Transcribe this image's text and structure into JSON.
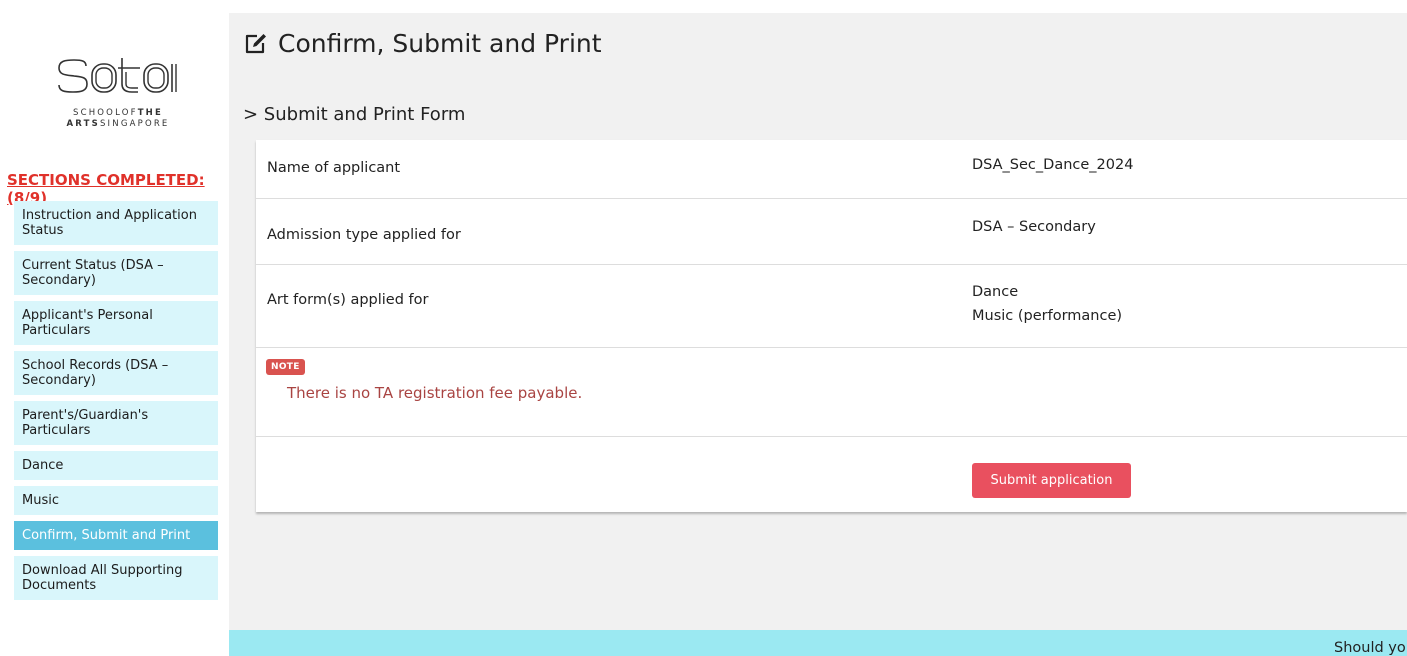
{
  "logo": {
    "wordmark": "sota",
    "line1_light": "SCHOOLOF",
    "line1_bold": "THE",
    "line2_bold": "ARTS",
    "line2_light": "SINGAPORE"
  },
  "sidebar": {
    "sections_completed": "SECTIONS COMPLETED:(8/9)",
    "items": [
      {
        "label": "Instruction and Application Status"
      },
      {
        "label": "Current Status (DSA – Secondary)"
      },
      {
        "label": "Applicant's Personal Particulars"
      },
      {
        "label": "School Records (DSA – Secondary)"
      },
      {
        "label": "Parent's/Guardian's Particulars"
      },
      {
        "label": "Dance"
      },
      {
        "label": "Music"
      },
      {
        "label": "Confirm, Submit and Print",
        "active": true
      },
      {
        "label": "Download All Supporting Documents"
      }
    ]
  },
  "main": {
    "title_icon": "edit-icon",
    "title": "Confirm, Submit and Print",
    "section_title": "> Submit and Print Form",
    "rows": [
      {
        "label": "Name of applicant",
        "value": "DSA_Sec_Dance_2024"
      },
      {
        "label": "Admission type applied for",
        "value": "DSA – Secondary"
      },
      {
        "label": "Art form(s) applied for",
        "values": [
          "Dance",
          "Music (performance)"
        ]
      }
    ],
    "note": {
      "badge": "NOTE",
      "text": "There is no TA registration fee payable."
    },
    "submit_label": "Submit application"
  },
  "footer": {
    "text": "Should yo"
  },
  "colors": {
    "accent": "#5bc0de",
    "nav_bg": "#d9f6fb",
    "danger": "#e9505f",
    "note_text": "#a94442",
    "footer_bg": "#9be9f2",
    "sections_red": "#e0312a"
  }
}
